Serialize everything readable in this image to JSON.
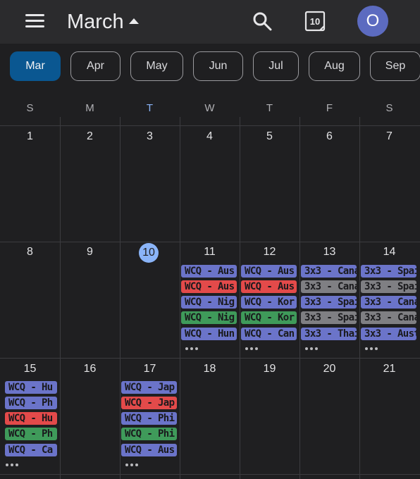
{
  "header": {
    "title": "March",
    "today_number": "10",
    "avatar_letter": "O"
  },
  "months": [
    "Mar",
    "Apr",
    "May",
    "Jun",
    "Jul",
    "Aug",
    "Sep"
  ],
  "weekdays": [
    "S",
    "M",
    "T",
    "W",
    "T",
    "F",
    "S"
  ],
  "weeks": [
    {
      "days": [
        "1",
        "2",
        "3",
        "4",
        "5",
        "6",
        "7"
      ]
    },
    {
      "days": [
        "8",
        "9",
        "10",
        "11",
        "12",
        "13",
        "14"
      ]
    },
    {
      "days": [
        "15",
        "16",
        "17",
        "18",
        "19",
        "20",
        "21"
      ]
    }
  ],
  "events": {
    "w2_wed": [
      "WCQ - Aus",
      "WCQ - Aus",
      "WCQ - Nig",
      "WCQ - Nig",
      "WCQ - Hun"
    ],
    "w2_thu": [
      "WCQ - Aus",
      "WCQ - Aus",
      "WCQ - Kor",
      "WCQ - Kor",
      "WCQ - Can"
    ],
    "w2_fri": [
      "3x3 - Cana",
      "3x3 - Cana",
      "3x3 - Spai",
      "3x3 - Spai",
      "3x3 - Thai"
    ],
    "w2_sat": [
      "3x3 - Spai",
      "3x3 - Spai",
      "3x3 - Cana",
      "3x3 - Cana",
      "3x3 - Aust"
    ],
    "w3_sun": [
      "WCQ - Hu",
      "WCQ - Ph",
      "WCQ - Hu",
      "WCQ - Ph",
      "WCQ - Ca"
    ],
    "w3_tue": [
      "WCQ - Jap",
      "WCQ - Jap",
      "WCQ - Phi",
      "WCQ - Phi",
      "WCQ - Aus"
    ]
  },
  "colors": {
    "selected_month": "#0a5791",
    "today": "#8ab4f8",
    "event_blue": "#6b74c9",
    "event_red": "#e34a4a",
    "event_green": "#3f9a5a",
    "event_gray": "#7f7f83",
    "avatar": "#5c6bc0"
  }
}
